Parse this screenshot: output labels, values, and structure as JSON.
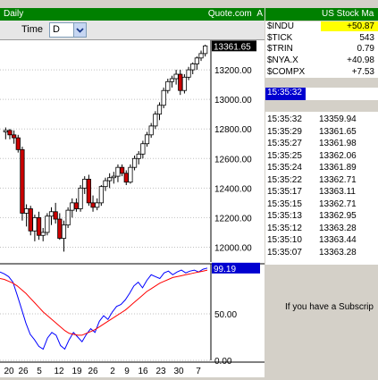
{
  "left_panel": {
    "title": "Daily",
    "source": "Quote.com",
    "source_suffix": "A",
    "toolbar": {
      "time_label": "Time",
      "time_value": "D"
    }
  },
  "chart_data": [
    {
      "type": "candlestick",
      "ylim": [
        11900,
        13400
      ],
      "y_ticks": [
        "13200.00",
        "13000.00",
        "12800.00",
        "12600.00",
        "12400.00",
        "12200.00",
        "12000.00"
      ],
      "last_price": "13361.65",
      "x_ticks": [
        "20",
        "26",
        "5",
        "12",
        "19",
        "26",
        "2",
        "9",
        "16",
        "23",
        "30",
        "7"
      ],
      "ohlc": [
        [
          12780,
          12810,
          12730,
          12790
        ],
        [
          12790,
          12800,
          12730,
          12760
        ],
        [
          12760,
          12790,
          12700,
          12740
        ],
        [
          12740,
          12760,
          12640,
          12660
        ],
        [
          12660,
          12680,
          12180,
          12230
        ],
        [
          12230,
          12290,
          12140,
          12260
        ],
        [
          12260,
          12280,
          12080,
          12110
        ],
        [
          12110,
          12220,
          12040,
          12200
        ],
        [
          12200,
          12240,
          12050,
          12080
        ],
        [
          12080,
          12130,
          12040,
          12100
        ],
        [
          12100,
          12230,
          12080,
          12210
        ],
        [
          12210,
          12270,
          12150,
          12240
        ],
        [
          12240,
          12300,
          12160,
          12190
        ],
        [
          12190,
          12230,
          12050,
          12060
        ],
        [
          12060,
          12180,
          11970,
          12150
        ],
        [
          12150,
          12270,
          12130,
          12250
        ],
        [
          12250,
          12330,
          12200,
          12300
        ],
        [
          12300,
          12330,
          12240,
          12260
        ],
        [
          12260,
          12420,
          12240,
          12400
        ],
        [
          12400,
          12480,
          12360,
          12460
        ],
        [
          12460,
          12490,
          12280,
          12300
        ],
        [
          12300,
          12350,
          12240,
          12270
        ],
        [
          12270,
          12330,
          12250,
          12300
        ],
        [
          12300,
          12420,
          12280,
          12410
        ],
        [
          12410,
          12470,
          12380,
          12450
        ],
        [
          12450,
          12500,
          12400,
          12470
        ],
        [
          12470,
          12510,
          12430,
          12480
        ],
        [
          12480,
          12560,
          12440,
          12540
        ],
        [
          12540,
          12560,
          12480,
          12500
        ],
        [
          12500,
          12520,
          12420,
          12440
        ],
        [
          12440,
          12560,
          12430,
          12540
        ],
        [
          12540,
          12620,
          12520,
          12600
        ],
        [
          12600,
          12650,
          12560,
          12630
        ],
        [
          12630,
          12720,
          12600,
          12700
        ],
        [
          12700,
          12780,
          12680,
          12760
        ],
        [
          12760,
          12840,
          12740,
          12820
        ],
        [
          12820,
          12920,
          12800,
          12900
        ],
        [
          12900,
          12980,
          12860,
          12960
        ],
        [
          12960,
          13080,
          12940,
          13060
        ],
        [
          13060,
          13140,
          13040,
          13120
        ],
        [
          13120,
          13160,
          13080,
          13140
        ],
        [
          13140,
          13200,
          13100,
          13170
        ],
        [
          13170,
          13200,
          13030,
          13060
        ],
        [
          13060,
          13170,
          13040,
          13150
        ],
        [
          13150,
          13220,
          13130,
          13200
        ],
        [
          13200,
          13250,
          13170,
          13240
        ],
        [
          13240,
          13290,
          13200,
          13280
        ],
        [
          13280,
          13330,
          13260,
          13310
        ],
        [
          13310,
          13370,
          13290,
          13361.65
        ]
      ]
    },
    {
      "type": "line",
      "ylim": [
        0,
        100
      ],
      "y_ticks": [
        "50.00",
        "0.00"
      ],
      "last_value": "99.19",
      "series": [
        {
          "color": "#0000ff",
          "values": [
            95,
            93,
            90,
            84,
            70,
            55,
            40,
            28,
            22,
            15,
            12,
            24,
            30,
            27,
            16,
            12,
            22,
            30,
            25,
            20,
            28,
            34,
            30,
            42,
            48,
            44,
            52,
            58,
            60,
            65,
            72,
            80,
            84,
            78,
            86,
            92,
            90,
            88,
            94,
            96,
            92,
            95,
            97,
            94,
            96,
            97,
            95,
            98,
            99.19
          ]
        },
        {
          "color": "#ff0000",
          "values": [
            88,
            87,
            85,
            83,
            80,
            76,
            72,
            67,
            62,
            57,
            52,
            48,
            44,
            40,
            36,
            32,
            29,
            28,
            27,
            27,
            29,
            31,
            33,
            36,
            39,
            42,
            45,
            48,
            51,
            54,
            58,
            62,
            66,
            70,
            74,
            77,
            80,
            83,
            85,
            87,
            89,
            90,
            91,
            92,
            93,
            94,
            95,
            96,
            97
          ]
        }
      ]
    }
  ],
  "right_panel": {
    "title": "US Stock Ma",
    "indices": [
      {
        "symbol": "$INDU",
        "value": "+50.87"
      },
      {
        "symbol": "$TICK",
        "value": "543"
      },
      {
        "symbol": "$TRIN",
        "value": "0.79"
      },
      {
        "symbol": "$NYA.X",
        "value": "+40.98"
      },
      {
        "symbol": "$COMPX",
        "value": "+7.53"
      }
    ],
    "time_now": "15:35:32",
    "ticks": [
      {
        "time": "15:35:32",
        "price": "13359.94"
      },
      {
        "time": "15:35:29",
        "price": "13361.65"
      },
      {
        "time": "15:35:27",
        "price": "13361.98"
      },
      {
        "time": "15:35:25",
        "price": "13362.06"
      },
      {
        "time": "15:35:24",
        "price": "13361.89"
      },
      {
        "time": "15:35:22",
        "price": "13362.71"
      },
      {
        "time": "15:35:17",
        "price": "13363.11"
      },
      {
        "time": "15:35:15",
        "price": "13362.71"
      },
      {
        "time": "15:35:13",
        "price": "13362.95"
      },
      {
        "time": "15:35:12",
        "price": "13363.28"
      },
      {
        "time": "15:35:10",
        "price": "13363.44"
      },
      {
        "time": "15:35:07",
        "price": "13363.28"
      }
    ],
    "subscribe_message": "If you have a Subscrip"
  },
  "colors": {
    "up": "#ffffff",
    "down": "#cc0000",
    "title_bar": "#008000",
    "highlight": "#ffff00",
    "selected": "#0000d0"
  }
}
